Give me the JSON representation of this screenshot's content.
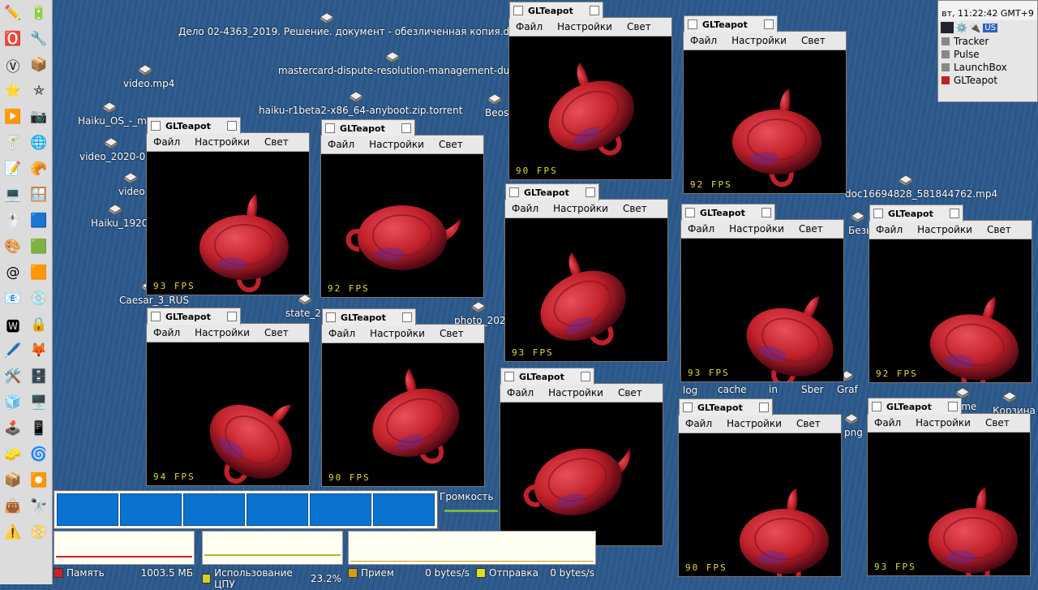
{
  "deskbar": {
    "clock": "вт, 11:22:42 GMT+9",
    "lang": "US",
    "items": [
      {
        "label": "Tracker",
        "icon": "tracker-icon"
      },
      {
        "label": "Pulse",
        "icon": "pulse-icon"
      },
      {
        "label": "LaunchBox",
        "icon": "launchbox-icon"
      },
      {
        "label": "GLTeapot",
        "icon": "teapot-icon"
      }
    ]
  },
  "desktop": [
    "Дело 02-4363_2019. Решение. документ - обезличенная копия.doc",
    "mastercard-dispute-resolution-management-during",
    "video.mp4",
    "haiku-r1beta2-x86_64-anyboot.zip.torrent",
    "Haiku_OS_-_my",
    "video_2020-06",
    "video",
    "Haiku_1920",
    "Caesar_3_RUS",
    "state_20",
    "photo_2020",
    "doc16694828_581844762.mp4",
    "log",
    "cache",
    "in",
    "Sber",
    "Graf",
    "png",
    "Корзина",
    "ome",
    "Безы",
    "Beos"
  ],
  "menu": {
    "file": "Файл",
    "settings": "Настройки",
    "light": "Свет"
  },
  "windows": [
    {
      "title": "GLTeapot",
      "fps": "93 FPS"
    },
    {
      "title": "GLTeapot",
      "fps": "92 FPS"
    },
    {
      "title": "GLTeapot",
      "fps": "94 FPS"
    },
    {
      "title": "GLTeapot",
      "fps": "90 FPS"
    },
    {
      "title": "GLTeapot",
      "fps": "90 FPS"
    },
    {
      "title": "GLTeapot",
      "fps": "92 FPS"
    },
    {
      "title": "GLTeapot",
      "fps": "93 FPS"
    },
    {
      "title": "GLTeapot",
      "fps": "93 FPS"
    },
    {
      "title": "GLTeapot",
      "fps": "92 FPS"
    },
    {
      "title": "GLTeapot",
      "fps": "90 FPS"
    },
    {
      "title": "GLTeapot",
      "fps": "90 FPS"
    },
    {
      "title": "GLTeapot",
      "fps": "93 FPS"
    }
  ],
  "replicants": {
    "volume": "Громкость",
    "memory_label": "Память",
    "memory_value": "1003.5 МБ",
    "cpu_label": "Использование ЦПУ",
    "cpu_value": "23.2%",
    "rx_label": "Прием",
    "rx_value": "0 bytes/s",
    "tx_label": "Отправка",
    "tx_value": "0 bytes/s"
  },
  "colors": {
    "teapot": "#c0202a",
    "fps": "#e3d640",
    "desktop": "#2c5a8c",
    "pulse": "#0a73d0"
  }
}
